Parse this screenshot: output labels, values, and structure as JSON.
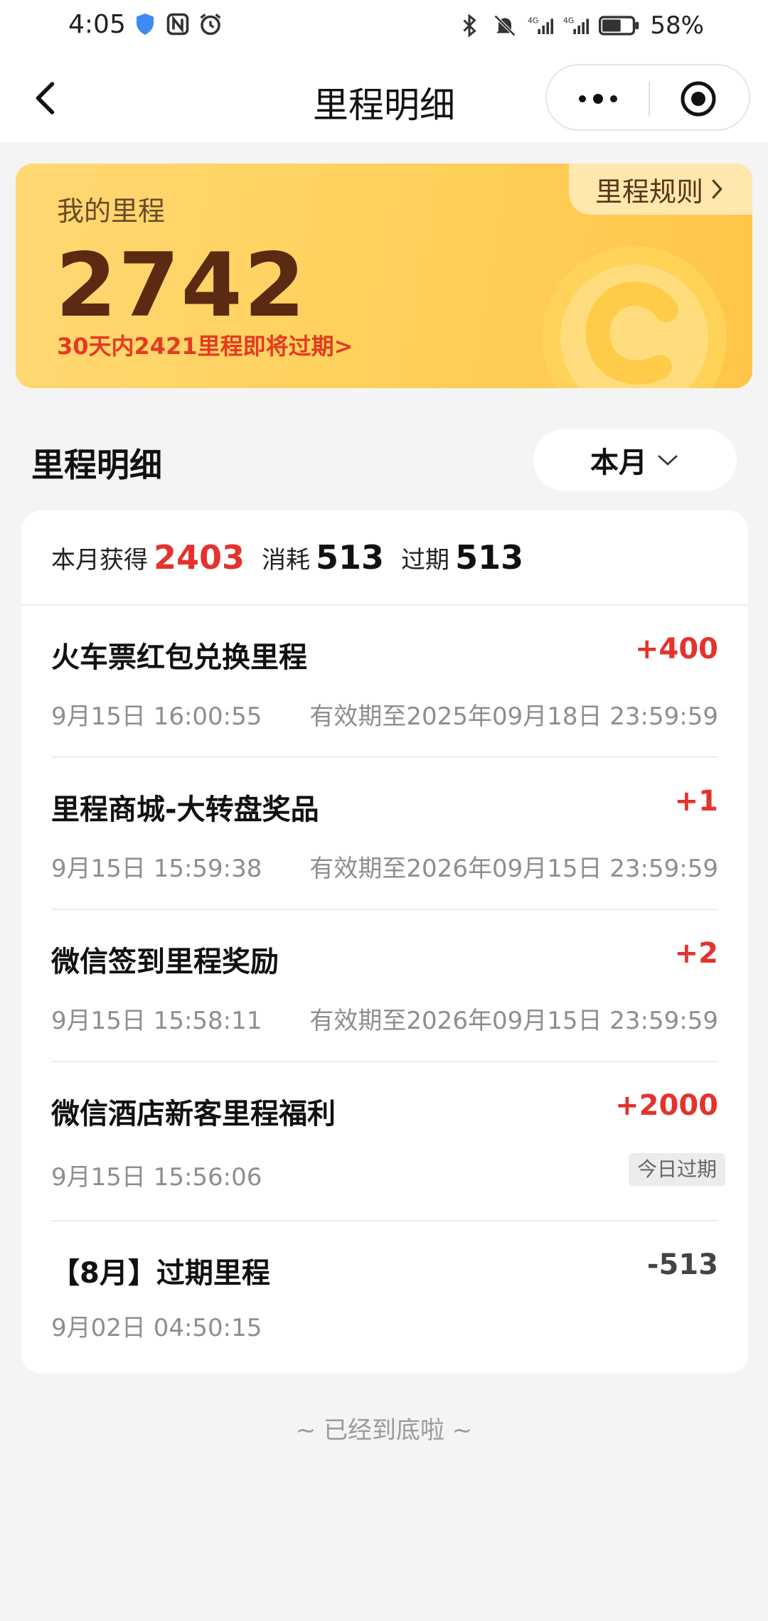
{
  "status_bar": {
    "time": "4:05",
    "battery": "58%",
    "icons": [
      "shield-icon",
      "nfc-icon",
      "alarm-icon",
      "bluetooth-icon",
      "bell-off-icon",
      "signal-4g-icon",
      "signal-4g-icon",
      "battery-icon"
    ]
  },
  "nav": {
    "title": "里程明细",
    "back_icon": "chevron-left-icon",
    "capsule": [
      "more-icon",
      "target-icon"
    ]
  },
  "miles_card": {
    "label": "我的里程",
    "total": "2742",
    "expiry_notice": "30天内2421里程即将过期>",
    "rules_label": "里程规则",
    "rules_icon": "chevron-right-icon",
    "gradient_colors": [
      "#ffd874",
      "#ffc548"
    ],
    "number_color": "#5a2a12",
    "notice_color": "#e53a22"
  },
  "detail": {
    "section_title": "里程明细",
    "filter_label": "本月",
    "summary": {
      "earned_label": "本月获得",
      "earned_value": "2403",
      "consumed_label": "消耗",
      "consumed_value": "513",
      "expired_label": "过期",
      "expired_value": "513"
    },
    "items": [
      {
        "name": "火车票红包兑换里程",
        "amount": "+400",
        "time": "9月15日 16:00:55",
        "valid": "有效期至2025年09月18日 23:59:59"
      },
      {
        "name": "里程商城-大转盘奖品",
        "amount": "+1",
        "time": "9月15日 15:59:38",
        "valid": "有效期至2026年09月15日 23:59:59"
      },
      {
        "name": "微信签到里程奖励",
        "amount": "+2",
        "time": "9月15日 15:58:11",
        "valid": "有效期至2026年09月15日 23:59:59"
      },
      {
        "name": "微信酒店新客里程福利",
        "amount": "+2000",
        "time": "9月15日 15:56:06",
        "badge": "今日过期"
      },
      {
        "name": "【8月】过期里程",
        "amount": "-513",
        "time": "9月02日 04:50:15"
      }
    ]
  },
  "footer": "~ 已经到底啦 ~",
  "colors": {
    "accent_red": "#e5322d",
    "background": "#f4f4f4"
  }
}
